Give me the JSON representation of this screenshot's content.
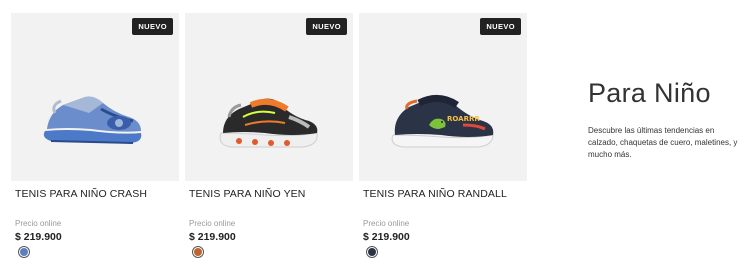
{
  "products": [
    {
      "badge": "NUEVO",
      "name": "TENIS PARA NIÑO CRASH",
      "price_label": "Precio online",
      "price": "$ 219.900",
      "swatch_color": "#5a7fbf",
      "image_icon": "sneaker-blue-icon"
    },
    {
      "badge": "NUEVO",
      "name": "TENIS PARA NIÑO YEN",
      "price_label": "Precio online",
      "price": "$ 219.900",
      "swatch_color": "#c0652d",
      "image_icon": "sneaker-black-orange-icon"
    },
    {
      "badge": "NUEVO",
      "name": "TENIS PARA NIÑO RANDALL",
      "price_label": "Precio online",
      "price": "$ 219.900",
      "swatch_color": "#2b3347",
      "image_icon": "sneaker-navy-dino-icon"
    }
  ],
  "promo": {
    "title": "Para Niño",
    "text": "Descubre las últimas tendencias en calzado, chaquetas de cuero, maletines, y mucho más."
  },
  "colors": {
    "badge_bg": "#222222",
    "image_bg": "#f2f2f2",
    "price_label": "#9a9a9a"
  }
}
